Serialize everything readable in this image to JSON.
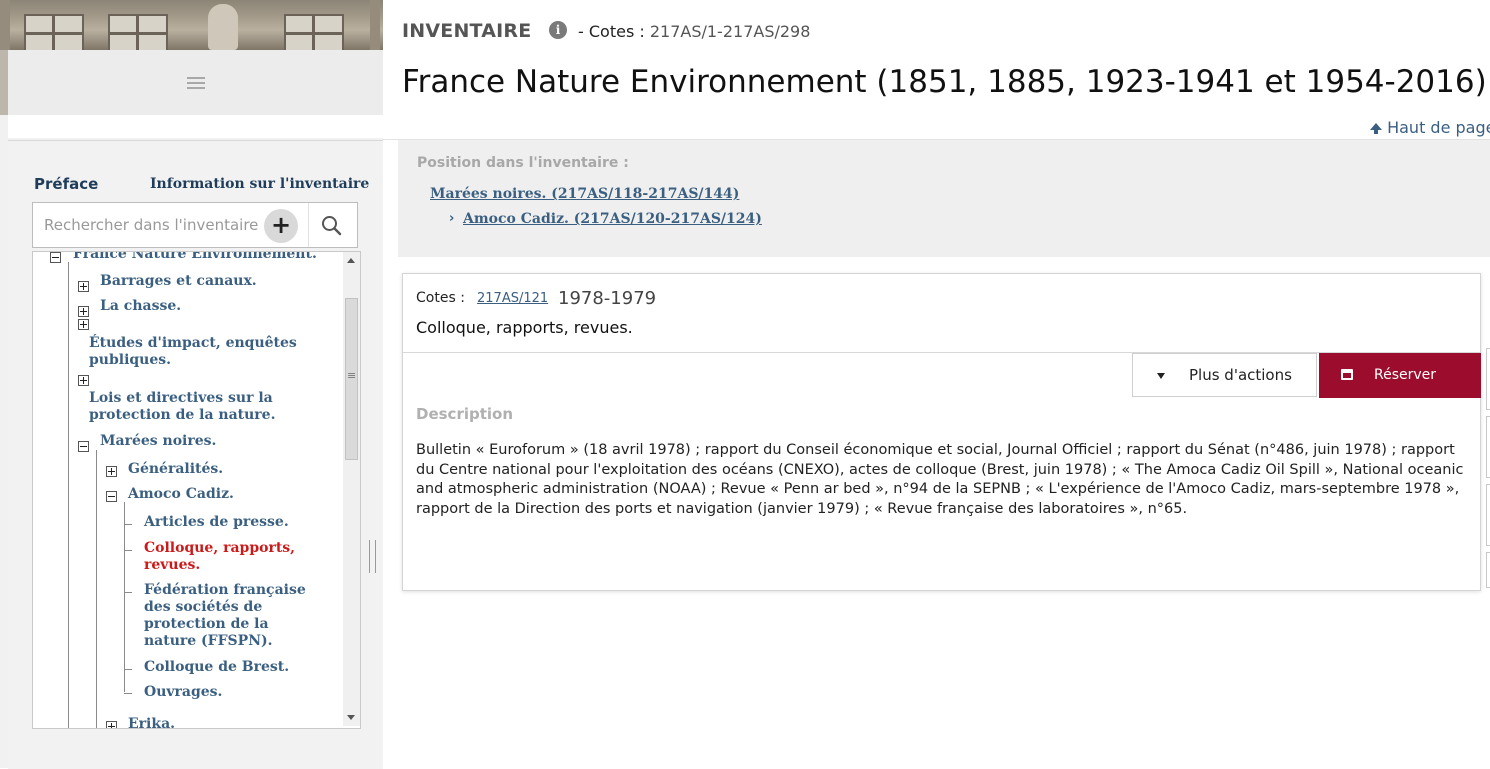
{
  "header": {
    "section_label": "INVENTAIRE",
    "info_icon": "info-icon",
    "cotes_prefix": "- Cotes :",
    "cotes_range": "217AS/1-217AS/298",
    "title": "France Nature Environnement (1851, 1885, 1923-1941 et 1954-2016)",
    "back_to_top": "Haut de page"
  },
  "sidebar": {
    "menu_icon": "hamburger-menu-icon",
    "tab_preface": "Préface",
    "tab_info": "Information sur l'inventaire",
    "search": {
      "placeholder": "Rechercher dans l'inventaire",
      "add_label": "+",
      "search_icon": "magnifier-icon"
    },
    "tree": {
      "root": "France Nature Environnement.",
      "items": [
        {
          "label": "Barrages et canaux.",
          "toggle": "plus"
        },
        {
          "label": "La chasse.",
          "toggle": "plus"
        },
        {
          "label": "Études d'impact, enquêtes publiques.",
          "toggle": "plus"
        },
        {
          "label": "Lois et directives sur la protection de la nature.",
          "toggle": "plus"
        },
        {
          "label": "Marées noires.",
          "toggle": "minus"
        },
        {
          "label": "Généralités.",
          "toggle": "plus"
        },
        {
          "label": "Amoco Cadiz.",
          "toggle": "minus"
        },
        {
          "label": "Articles de presse."
        },
        {
          "label": "Colloque, rapports, revues.",
          "active": true
        },
        {
          "label": "Fédération française des sociétés de protection de la nature (FFSPN)."
        },
        {
          "label": "Colloque de Brest."
        },
        {
          "label": "Ouvrages."
        },
        {
          "label": "Erika.",
          "toggle": "plus"
        }
      ]
    }
  },
  "position": {
    "title": "Position dans l'inventaire :",
    "level1": "Marées noires. (217AS/118-217AS/144)",
    "chevron": "›",
    "level2": "Amoco Cadiz. (217AS/120-217AS/124)"
  },
  "record": {
    "cotes_label": "Cotes :",
    "cote": "217AS/121",
    "dates": "1978-1979",
    "title": "Colloque, rapports, revues.",
    "more_actions": "Plus d'actions",
    "reserve": "Réserver",
    "description_label": "Description",
    "description": "Bulletin « Euroforum » (18 avril 1978) ; rapport du Conseil économique et social, Journal Officiel ; rapport du Sénat (n°486, juin 1978) ; rapport du Centre national pour l'exploitation des océans (CNEXO), actes de colloque (Brest, juin 1978) ; « The Amoca Cadiz Oil Spill », National oceanic and atmospheric administration (NOAA) ; Revue « Penn ar bed », n°94 de la SEPNB ; « L'expérience de l'Amoco Cadiz, mars-septembre 1978 », rapport de la Direction des ports et navigation (janvier 1979) ; « Revue française des laboratoires », n°65."
  },
  "colors": {
    "link": "#3a5f80",
    "active_node": "#cc1a1a",
    "reserve_button": "#9c0c2c"
  }
}
